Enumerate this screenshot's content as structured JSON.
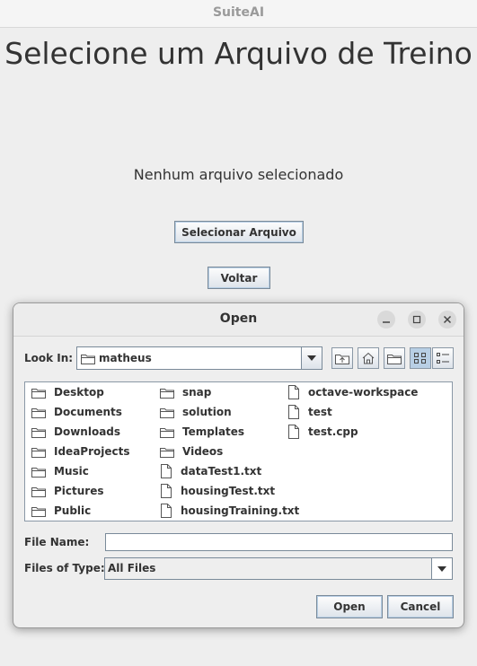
{
  "window": {
    "title": "SuiteAI"
  },
  "main": {
    "heading": "Selecione um Arquivo de Treino",
    "status": "Nenhum arquivo selecionado",
    "select_button": "Selecionar Arquivo",
    "back_button": "Voltar"
  },
  "dialog": {
    "title": "Open",
    "look_in_label": "Look In:",
    "look_in_value": "matheus",
    "toolbar_icons": [
      "up-one-level-icon",
      "home-icon",
      "new-folder-icon",
      "list-view-icon",
      "details-view-icon"
    ],
    "files": [
      {
        "name": "Desktop",
        "type": "folder"
      },
      {
        "name": "Documents",
        "type": "folder"
      },
      {
        "name": "Downloads",
        "type": "folder"
      },
      {
        "name": "IdeaProjects",
        "type": "folder"
      },
      {
        "name": "Music",
        "type": "folder"
      },
      {
        "name": "Pictures",
        "type": "folder"
      },
      {
        "name": "Public",
        "type": "folder"
      },
      {
        "name": "snap",
        "type": "folder"
      },
      {
        "name": "solution",
        "type": "folder"
      },
      {
        "name": "Templates",
        "type": "folder"
      },
      {
        "name": "Videos",
        "type": "folder"
      },
      {
        "name": "dataTest1.txt",
        "type": "file"
      },
      {
        "name": "housingTest.txt",
        "type": "file"
      },
      {
        "name": "housingTraining.txt",
        "type": "file"
      },
      {
        "name": "octave-workspace",
        "type": "file"
      },
      {
        "name": "test",
        "type": "file"
      },
      {
        "name": "test.cpp",
        "type": "file"
      }
    ],
    "file_name_label": "File Name:",
    "file_name_value": "",
    "file_type_label": "Files of Type:",
    "file_type_value": "All Files",
    "open_button": "Open",
    "cancel_button": "Cancel"
  }
}
